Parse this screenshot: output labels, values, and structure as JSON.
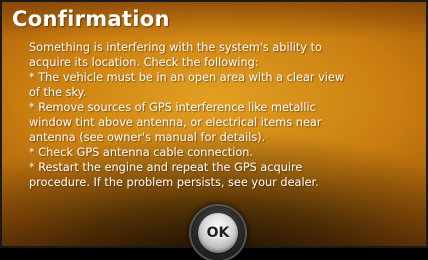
{
  "dialog": {
    "title": "Confirmation",
    "message_lines": [
      "Something is interfering with the system's ability to",
      "acquire its location. Check the following:",
      "* The vehicle must be in an open area with a clear view",
      "of the sky.",
      "* Remove sources of GPS interference like metallic",
      "window tint above antenna, or electrical items near",
      "antenna (see owner's manual for details).",
      "* Check GPS antenna cable connection.",
      "* Restart the engine and repeat the GPS acquire",
      "procedure. If the problem persists, see your dealer."
    ],
    "ok_label": "OK"
  },
  "colors": {
    "background": "#c97d10",
    "text": "#ffffff",
    "button": "#dcdcdc"
  }
}
